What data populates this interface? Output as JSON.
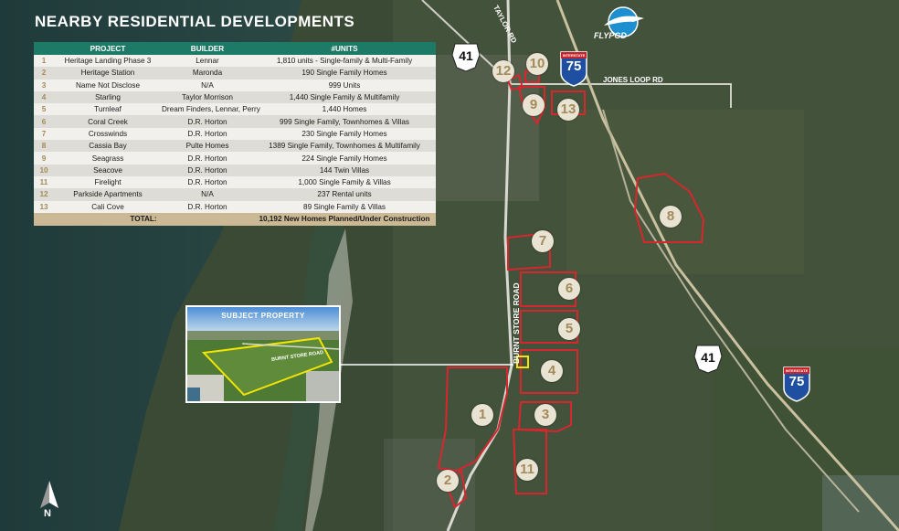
{
  "title": "NEARBY RESIDENTIAL DEVELOPMENTS",
  "table": {
    "headers": [
      "PROJECT",
      "BUILDER",
      "#UNITS"
    ],
    "rows": [
      {
        "num": "1",
        "project": "Heritage Landing Phase 3",
        "builder": "Lennar",
        "units": "1,810 units - Single-family & Multi-Family"
      },
      {
        "num": "2",
        "project": "Heritage Station",
        "builder": "Maronda",
        "units": "190 Single Family Homes"
      },
      {
        "num": "3",
        "project": "Name Not Disclose",
        "builder": "N/A",
        "units": "999 Units"
      },
      {
        "num": "4",
        "project": "Starling",
        "builder": "Taylor Morrison",
        "units": "1,440  Single Family & Multifamily"
      },
      {
        "num": "5",
        "project": "Turnleaf",
        "builder": "Dream Finders, Lennar, Perry",
        "units": "1,440 Homes"
      },
      {
        "num": "6",
        "project": "Coral Creek",
        "builder": "D.R. Horton",
        "units": "999 Single Family, Townhomes & Villas"
      },
      {
        "num": "7",
        "project": "Crosswinds",
        "builder": "D.R. Horton",
        "units": "230 Single Family Homes"
      },
      {
        "num": "8",
        "project": "Cassia Bay",
        "builder": "Pulte Homes",
        "units": "1389 Single Family, Townhomes & Multifamily"
      },
      {
        "num": "9",
        "project": "Seagrass",
        "builder": "D.R. Horton",
        "units": "224 Single Family Homes"
      },
      {
        "num": "10",
        "project": "Seacove",
        "builder": "D.R. Horton",
        "units": "144 Twin Villas"
      },
      {
        "num": "11",
        "project": "Firelight",
        "builder": "D.R. Horton",
        "units": "1,000 Single Family & Villas"
      },
      {
        "num": "12",
        "project": "Parkside Apartments",
        "builder": "N/A",
        "units": "237 Rental units"
      },
      {
        "num": "13",
        "project": "Cali Cove",
        "builder": "D.R. Horton",
        "units": "89 Single Family & Villas"
      }
    ],
    "total_label": "TOTAL:",
    "total_value": "10,192 New Homes Planned/Under Construction"
  },
  "markers": [
    "1",
    "2",
    "3",
    "4",
    "5",
    "6",
    "7",
    "8",
    "9",
    "10",
    "11",
    "12",
    "13"
  ],
  "inset": {
    "title": "SUBJECT PROPERTY",
    "road": "BURNT STORE ROAD"
  },
  "roads": {
    "taylor": "TAYLOR RD",
    "jones": "JONES LOOP RD",
    "burnt": "BURNT STORE ROAD",
    "us41": "41",
    "i75_word": "INTERSTATE",
    "i75": "75"
  },
  "logo": {
    "text": "FLYPGD"
  },
  "north": "N",
  "colors": {
    "header_green": "#1d7a66",
    "accent_gold": "#a38a5a",
    "boundary_red": "#d8262e",
    "subject_yellow": "#f2e600"
  }
}
